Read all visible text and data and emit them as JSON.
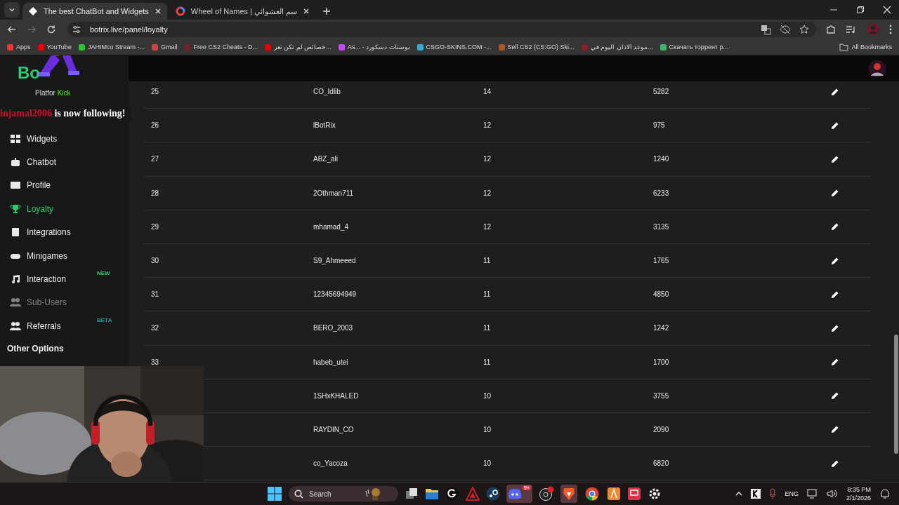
{
  "browser": {
    "tabs": [
      {
        "title": "The best ChatBot and Widgets",
        "selected": true
      },
      {
        "title": "Wheel of Names | سم العشوائي",
        "selected": false
      }
    ],
    "address": "botrix.live/panel/loyalty",
    "bookmarks": [
      "Apps",
      "YouTube",
      "JAHIMco Stream -...",
      "Gmail",
      "Free CS2 Cheats - D...",
      "خصائص لم تكن تعر...",
      "As... - بوستات دسكورد",
      "CSGO-SKINS.COM -...",
      "Sell CS2 (CS:GO) Ski...",
      "موعد الاذان اليوم في...",
      "Скачать торрент р..."
    ],
    "all_bookmarks": "All Bookmarks"
  },
  "sidebar": {
    "logo": "Bo",
    "platform_label": "Platfor",
    "platform_value": "Kick",
    "items": [
      {
        "label": "Widgets",
        "selected": false,
        "disabled": false
      },
      {
        "label": "Chatbot",
        "selected": false,
        "disabled": false
      },
      {
        "label": "Profile",
        "selected": false,
        "disabled": false
      },
      {
        "label": "Loyalty",
        "selected": true,
        "disabled": false
      },
      {
        "label": "Integrations",
        "selected": false,
        "disabled": false
      },
      {
        "label": "Minigames",
        "selected": false,
        "disabled": false
      },
      {
        "label": "Interaction",
        "selected": false,
        "disabled": false,
        "badge": "NEW",
        "color": "#2ecc71"
      },
      {
        "label": "Sub-Users",
        "selected": false,
        "disabled": true
      },
      {
        "label": "Referrals",
        "selected": false,
        "disabled": false,
        "badge": "BETA",
        "color": "#2a9fa0"
      }
    ],
    "section": "Other Options"
  },
  "alert": {
    "user": "injamal2006",
    "text": "is now following!"
  },
  "table": {
    "rows": [
      {
        "rank": "25",
        "name": "CO_Idlib",
        "column_3": "14",
        "column_4": "5282"
      },
      {
        "rank": "26",
        "name": "lBotRix",
        "column_3": "12",
        "column_4": "975"
      },
      {
        "rank": "27",
        "name": "ABZ_ali",
        "column_3": "12",
        "column_4": "1240"
      },
      {
        "rank": "28",
        "name": "2Othman711",
        "column_3": "12",
        "column_4": "6233"
      },
      {
        "rank": "29",
        "name": "mhamad_4",
        "column_3": "12",
        "column_4": "3135"
      },
      {
        "rank": "30",
        "name": "S9_Ahmeeed",
        "column_3": "11",
        "column_4": "1765"
      },
      {
        "rank": "31",
        "name": "12345694949",
        "column_3": "11",
        "column_4": "4850"
      },
      {
        "rank": "32",
        "name": "BERO_2003",
        "column_3": "11",
        "column_4": "1242"
      },
      {
        "rank": "33",
        "name": "habeb_utei",
        "column_3": "11",
        "column_4": "1700"
      },
      {
        "name": "1SHxKHALED",
        "column_3": "10",
        "column_4": "3755"
      },
      {
        "name": "RAYDIN_CO",
        "column_3": "10",
        "column_4": "2090"
      },
      {
        "name": "co_Yacoza",
        "column_3": "10",
        "column_4": "6820"
      }
    ]
  },
  "taskbar": {
    "search_placeholder": "Search",
    "notification_badge": "9+",
    "language": "ENG",
    "time": "8:35 PM",
    "date": "2/1/2026"
  }
}
